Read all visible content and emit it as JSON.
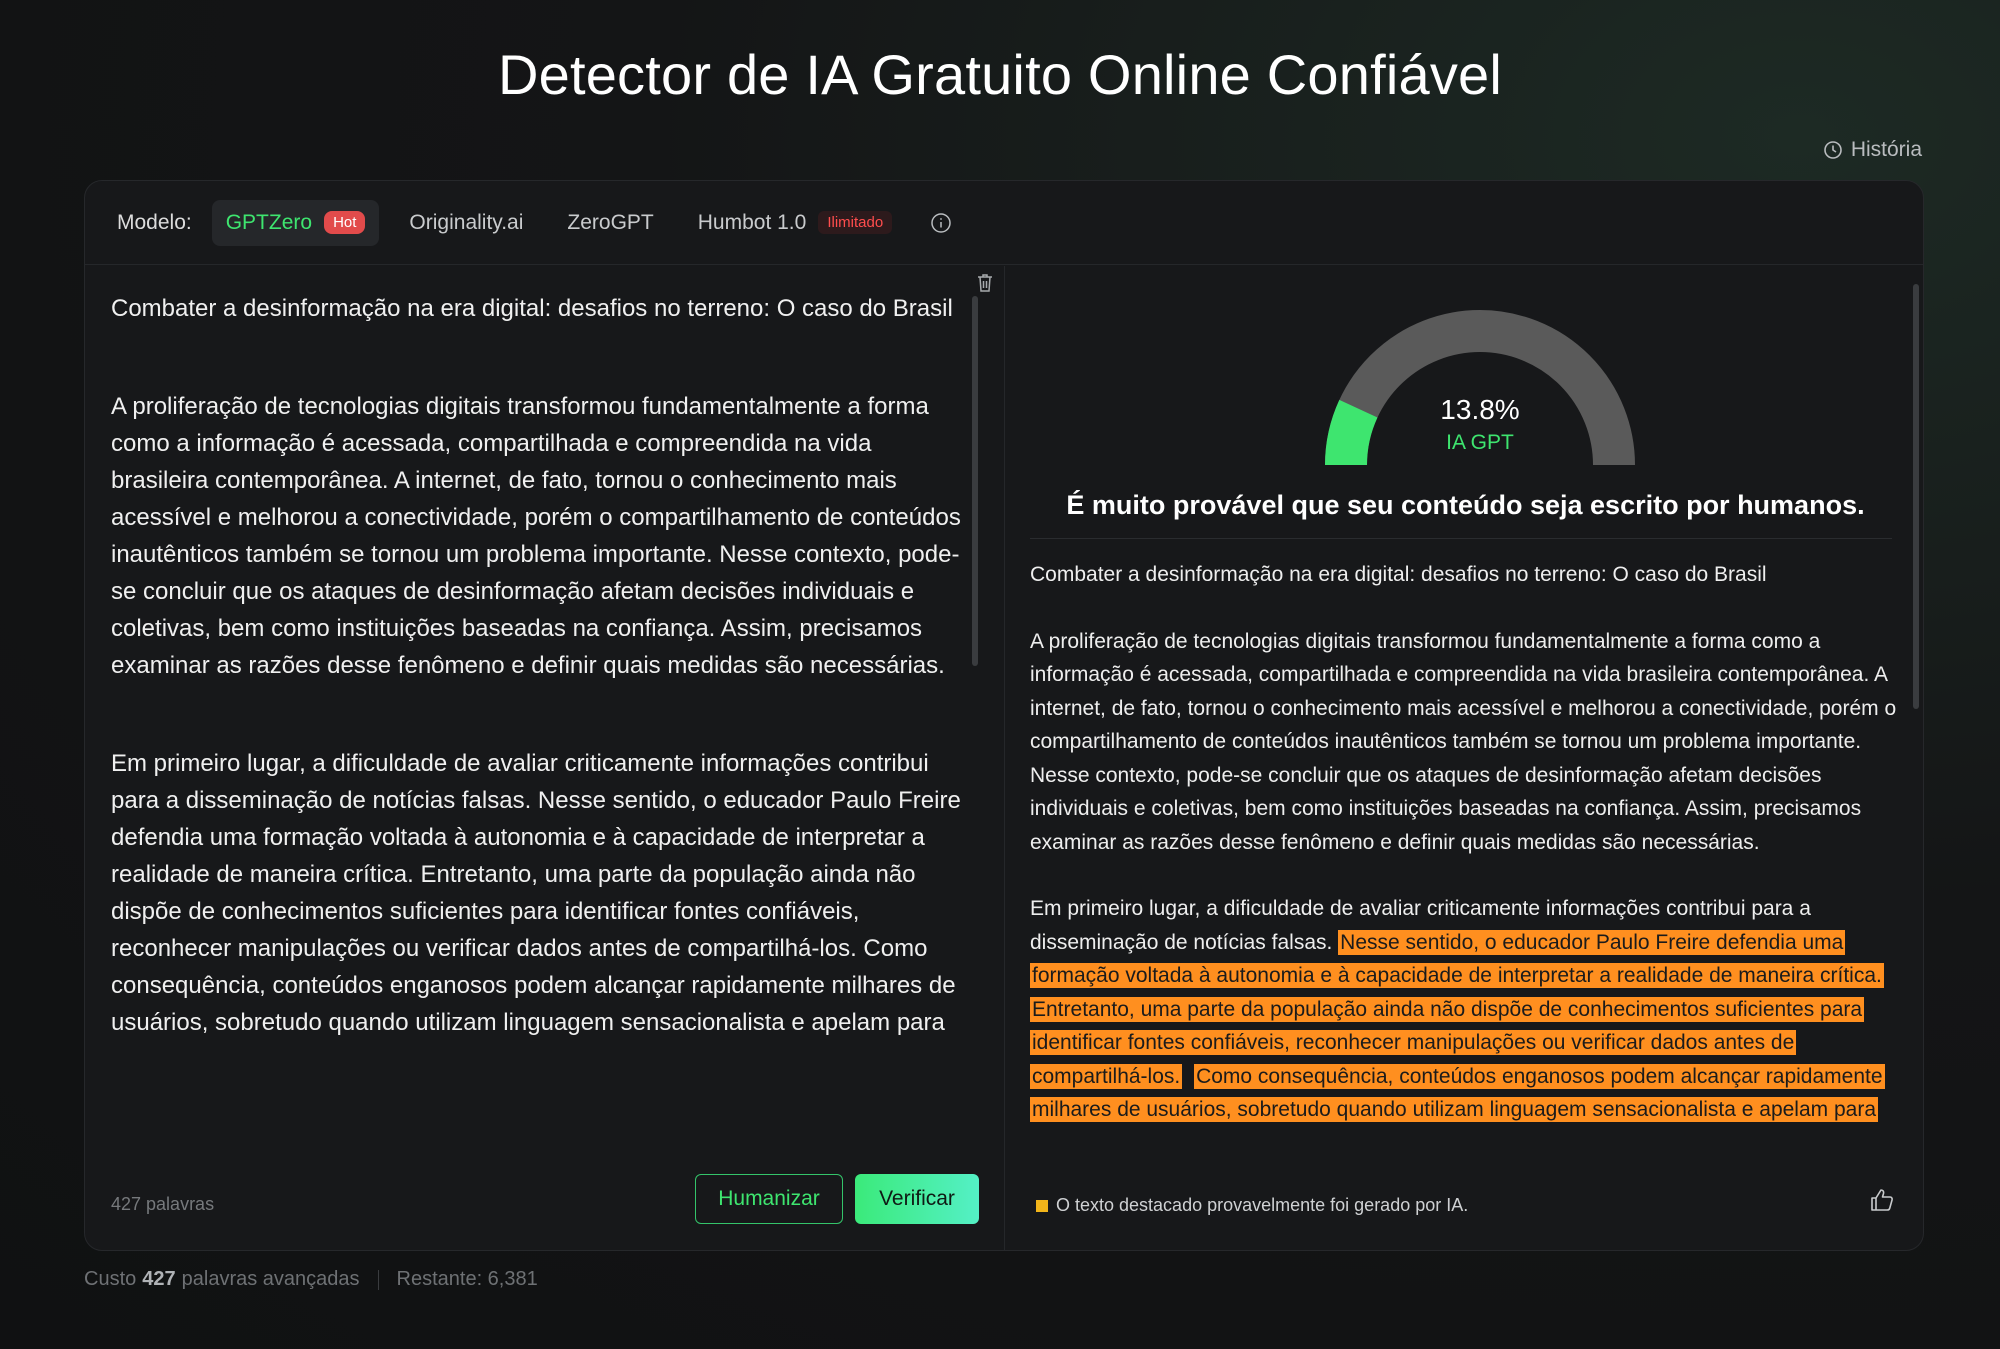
{
  "page": {
    "title": "Detector de IA Gratuito Online Confiável",
    "history_label": "História"
  },
  "model_bar": {
    "label": "Modelo:",
    "tabs": [
      {
        "label": "GPTZero",
        "badge": "Hot",
        "active": true
      },
      {
        "label": "Originality.ai"
      },
      {
        "label": "ZeroGPT"
      },
      {
        "label": "Humbot 1.0",
        "badge": "Ilimitado"
      }
    ]
  },
  "input": {
    "paragraphs": [
      "Combater a desinformação na era digital: desafios no terreno: O caso do Brasil",
      "A proliferação de tecnologias digitais transformou fundamentalmente a forma como a informação é acessada, compartilhada e compreendida na vida brasileira contemporânea. A internet, de fato, tornou o conhecimento mais acessível e melhorou a conectividade, porém o compartilhamento de conteúdos inautênticos também se tornou um problema importante. Nesse contexto, pode-se concluir que os ataques de desinformação afetam decisões individuais e coletivas, bem como instituições baseadas na confiança. Assim, precisamos examinar as razões desse fenômeno e definir quais medidas são necessárias.",
      "Em primeiro lugar, a dificuldade de avaliar criticamente informações contribui para a disseminação de notícias falsas. Nesse sentido, o educador Paulo Freire defendia uma formação voltada à autonomia e à capacidade de interpretar a realidade de maneira crítica. Entretanto, uma parte da população ainda não dispõe de conhecimentos suficientes para identificar fontes confiáveis, reconhecer manipulações ou verificar dados antes de compartilhá-los. Como consequência, conteúdos enganosos podem alcançar rapidamente milhares de usuários, sobretudo quando utilizam linguagem sensacionalista e apelam para"
    ],
    "word_count": "427 palavras",
    "humanize_label": "Humanizar",
    "verify_label": "Verificar"
  },
  "result": {
    "ai_percent": 13.8,
    "ai_percent_label": "13.8%",
    "ai_label": "IA GPT",
    "verdict": "É muito provável que seu conteúdo seja escrito por humanos.",
    "colors": {
      "gauge_ai": "#3ee56f",
      "gauge_track": "#5a5a5a",
      "highlight": "#ff8f1f"
    },
    "title_line": "Combater a desinformação na era digital: desafios no terreno: O caso do Brasil",
    "para1": "A proliferação de tecnologias digitais transformou fundamentalmente a forma como a informação é acessada, compartilhada e compreendida na vida brasileira contemporânea. A internet, de fato, tornou o conhecimento mais acessível e melhorou a conectividade, porém o compartilhamento de conteúdos inautênticos também se tornou um problema importante. Nesse contexto, pode-se concluir que os ataques de desinformação afetam decisões individuais e coletivas, bem como instituições baseadas na confiança. Assim, precisamos examinar as razões desse fenômeno e definir quais medidas são necessárias.",
    "para2_plain": "Em primeiro lugar, a dificuldade de avaliar criticamente informações contribui para a disseminação de notícias falsas.",
    "para2_highlights": [
      "Nesse sentido, o educador Paulo Freire defendia uma formação voltada à autonomia e à capacidade de interpretar a realidade de maneira crítica.",
      "Entretanto, uma parte da população ainda não dispõe de conhecimentos suficientes para identificar fontes confiáveis, reconhecer manipulações ou verificar dados antes de compartilhá-los.",
      "Como consequência, conteúdos enganosos podem alcançar rapidamente milhares de usuários, sobretudo quando utilizam linguagem sensacionalista e apelam para"
    ],
    "legend": "O texto destacado provavelmente foi gerado por IA."
  },
  "footer": {
    "cost_prefix": "Custo",
    "cost_value": "427",
    "cost_suffix": "palavras avançadas",
    "remaining": "Restante: 6,381"
  }
}
